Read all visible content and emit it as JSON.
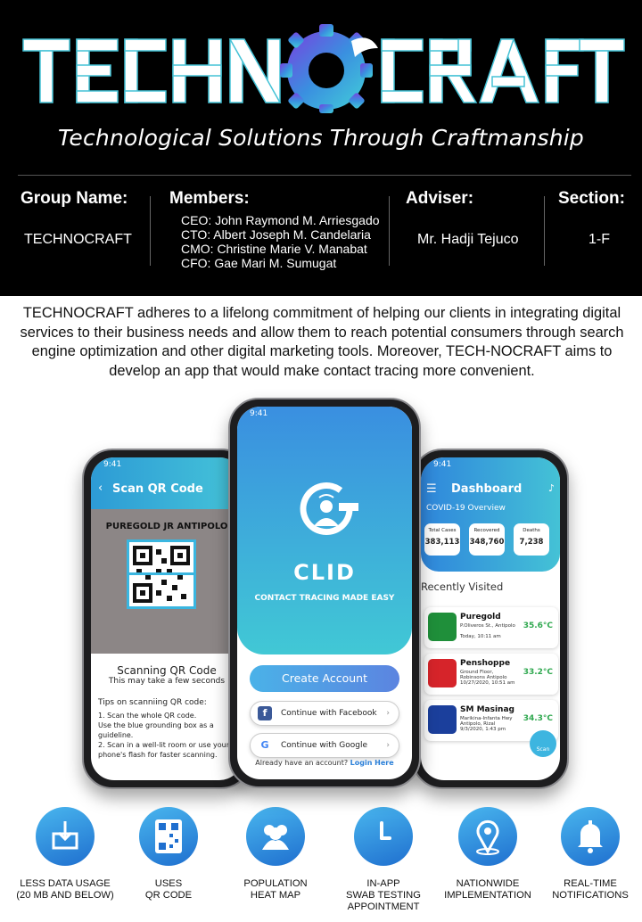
{
  "brand": {
    "logo_text": "TECHNOCRAFT",
    "tagline": "Technological Solutions Through Craftmanship",
    "colors": {
      "header_bg": "#000000",
      "accent_blue": "#2f86dc",
      "accent_cyan": "#44c2d6",
      "accent_purple": "#8a3fd6"
    }
  },
  "info": {
    "group_heading": "Group Name:",
    "group_value": "TECHNOCRAFT",
    "members_heading": "Members:",
    "members": [
      "CEO: John Raymond M. Arriesgado",
      "CTO: Albert Joseph M. Candelaria",
      "CMO: Christine Marie V. Manabat",
      "CFO: Gae Mari M. Sumugat"
    ],
    "adviser_heading": "Adviser:",
    "adviser_value": "Mr. Hadji Tejuco",
    "section_heading": "Section:",
    "section_value": "1-F"
  },
  "description": "TECHNOCRAFT adheres to a lifelong commitment of helping our clients in integrating digital services to their business needs and allow them to reach potential consumers through search engine optimization and other digital marketing tools. Moreover, TECH-NOCRAFT aims to develop an app that would make contact tracing more convenient.",
  "phones": {
    "status_time": "9:41",
    "scan": {
      "title": "Scan QR Code",
      "store": "PUREGOLD JR ANTIPOLO",
      "heading": "Scanning QR Code",
      "subheading": "This may take a few seconds",
      "tips_title": "Tips on scanniing QR code:",
      "tips": [
        "1. Scan the whole QR code.",
        "Use the blue grounding box as a guideline.",
        "2. Scan in a well-lit room or use your phone's flash for faster scanning."
      ]
    },
    "clid": {
      "name": "CLID",
      "subtitle": "CONTACT TRACING MADE EASY",
      "create_button": "Create Account",
      "facebook_button": "Continue with Facebook",
      "google_button": "Continue with Google",
      "have_account": "Already have an account?",
      "login_link": "Login Here"
    },
    "dashboard": {
      "title": "Dashboard",
      "covid_heading": "COVID-19 Overview",
      "stats": [
        {
          "label": "Total Cases",
          "value": "383,113"
        },
        {
          "label": "Recovered",
          "value": "348,760"
        },
        {
          "label": "Deaths",
          "value": "7,238"
        }
      ],
      "recent_heading": "Recently Visited",
      "places": [
        {
          "name": "Puregold",
          "address": "P.Oliveros St., Antipolo",
          "time": "Today, 10:11 am",
          "temp": "35.6°C",
          "color": "#1f8f3a"
        },
        {
          "name": "Penshoppe",
          "address": "Ground Floor, Robinsons Antipolo",
          "time": "10/27/2020, 10:51 am",
          "temp": "33.2°C",
          "color": "#d6242a"
        },
        {
          "name": "SM Masinag",
          "address": "Marikina-Infanta Hwy Antipolo, Rizal",
          "time": "9/3/2020, 1:43 pm",
          "temp": "34.3°C",
          "color": "#1b3f9c"
        }
      ],
      "scan_label": "Scan"
    }
  },
  "features": [
    {
      "label": "LESS DATA USAGE\n(20 MB AND BELOW)",
      "icon": "download-icon"
    },
    {
      "label": "USES\nQR CODE",
      "icon": "qr-code-icon"
    },
    {
      "label": "POPULATION\nHEAT MAP",
      "icon": "people-icon"
    },
    {
      "label": "IN-APP\nSWAB TESTING\nAPPOINTMENT",
      "icon": "clock-icon"
    },
    {
      "label": "NATIONWIDE\nIMPLEMENTATION",
      "icon": "location-pin-icon"
    },
    {
      "label": "REAL-TIME\nNOTIFICATIONS",
      "icon": "bell-icon"
    }
  ]
}
